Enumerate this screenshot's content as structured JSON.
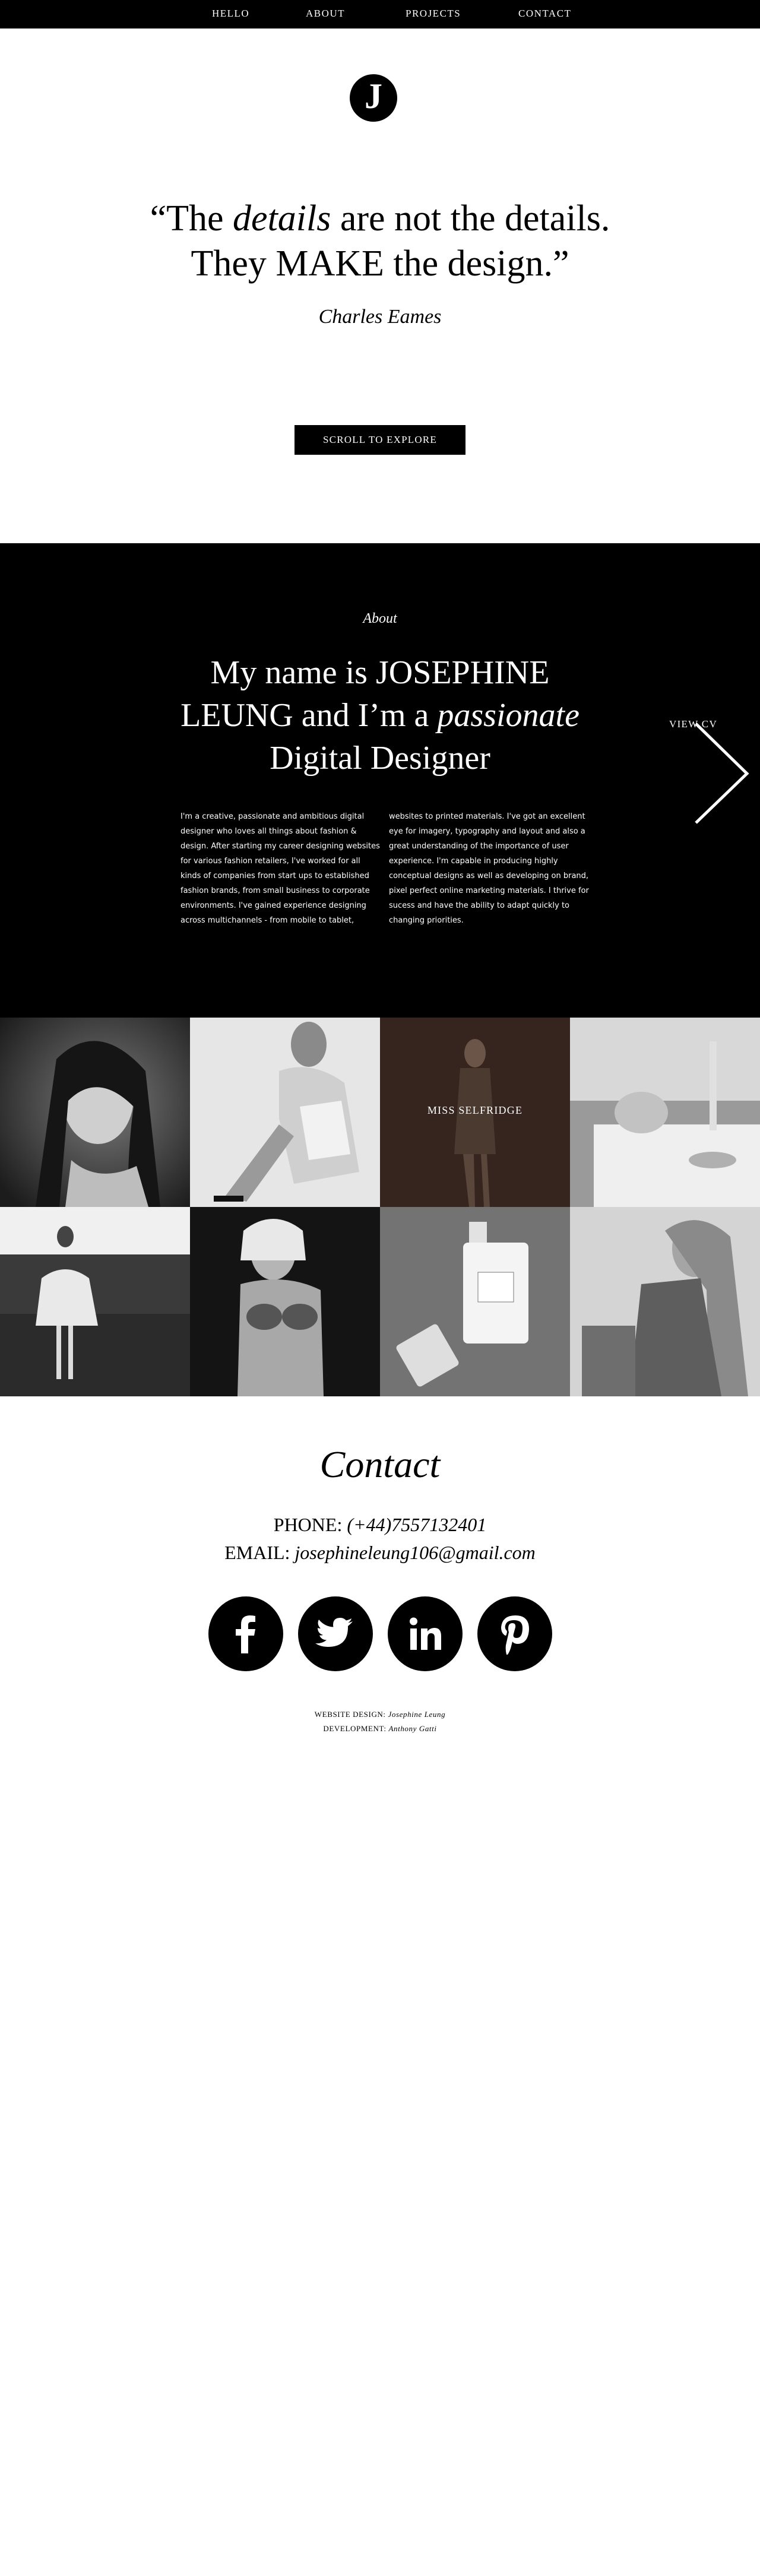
{
  "nav": {
    "items": [
      {
        "label": "HELLO"
      },
      {
        "label": "ABOUT"
      },
      {
        "label": "PROJECTS"
      },
      {
        "label": "CONTACT"
      }
    ]
  },
  "hero": {
    "logo_letter": "J",
    "quote_open": "“The ",
    "quote_em": "details",
    "quote_mid": " are not the details.",
    "quote_line2": "They MAKE the design.”",
    "author": "Charles Eames",
    "scroll_label": "SCROLL TO EXPLORE"
  },
  "about": {
    "label": "About",
    "heading_1": "My name is JOSEPHINE",
    "heading_2a": "LEUNG and I’m a ",
    "heading_2em": "passionate",
    "heading_3": "Digital Designer",
    "text_left": "I'm a creative, passionate and ambitious digital designer who loves all things about fashion & design. After starting my career designing websites for various fashion retailers, I've worked for all kinds of companies from start ups to established fashion brands, from small business to corporate environments. I've gained experience designing across multichannels - from mobile to tablet,",
    "text_right": "websites to printed materials. I've got an excellent eye for imagery, typography and layout and also a great understanding of the importance of user experience. I'm capable in producing highly conceptual designs as well as developing on brand, pixel perfect online marketing materials. I thrive for sucess and have the ability to adapt quickly to changing priorities.",
    "view_cv": "VIEW CV"
  },
  "gallery": {
    "hover_label": "MISS SELFRIDGE",
    "colors": [
      "#2b2b2b",
      "#cfcfcf",
      "#3a2a22",
      "#b9b9b9",
      "#555555",
      "#1a1a1a",
      "#6b6b6b",
      "#8d8d8d"
    ]
  },
  "contact": {
    "title": "Contact",
    "phone_label": "PHONE: ",
    "phone_value": "(+44)7557132401",
    "email_label": "EMAIL: ",
    "email_value": "josephineleung106@gmail.com",
    "social": [
      "facebook-icon",
      "twitter-icon",
      "linkedin-icon",
      "pinterest-icon"
    ],
    "design_label": "WEBSITE DESIGN: ",
    "design_name": "Josephine Leung",
    "dev_label": "DEVELOPMENT: ",
    "dev_name": "Anthony Gatti"
  }
}
